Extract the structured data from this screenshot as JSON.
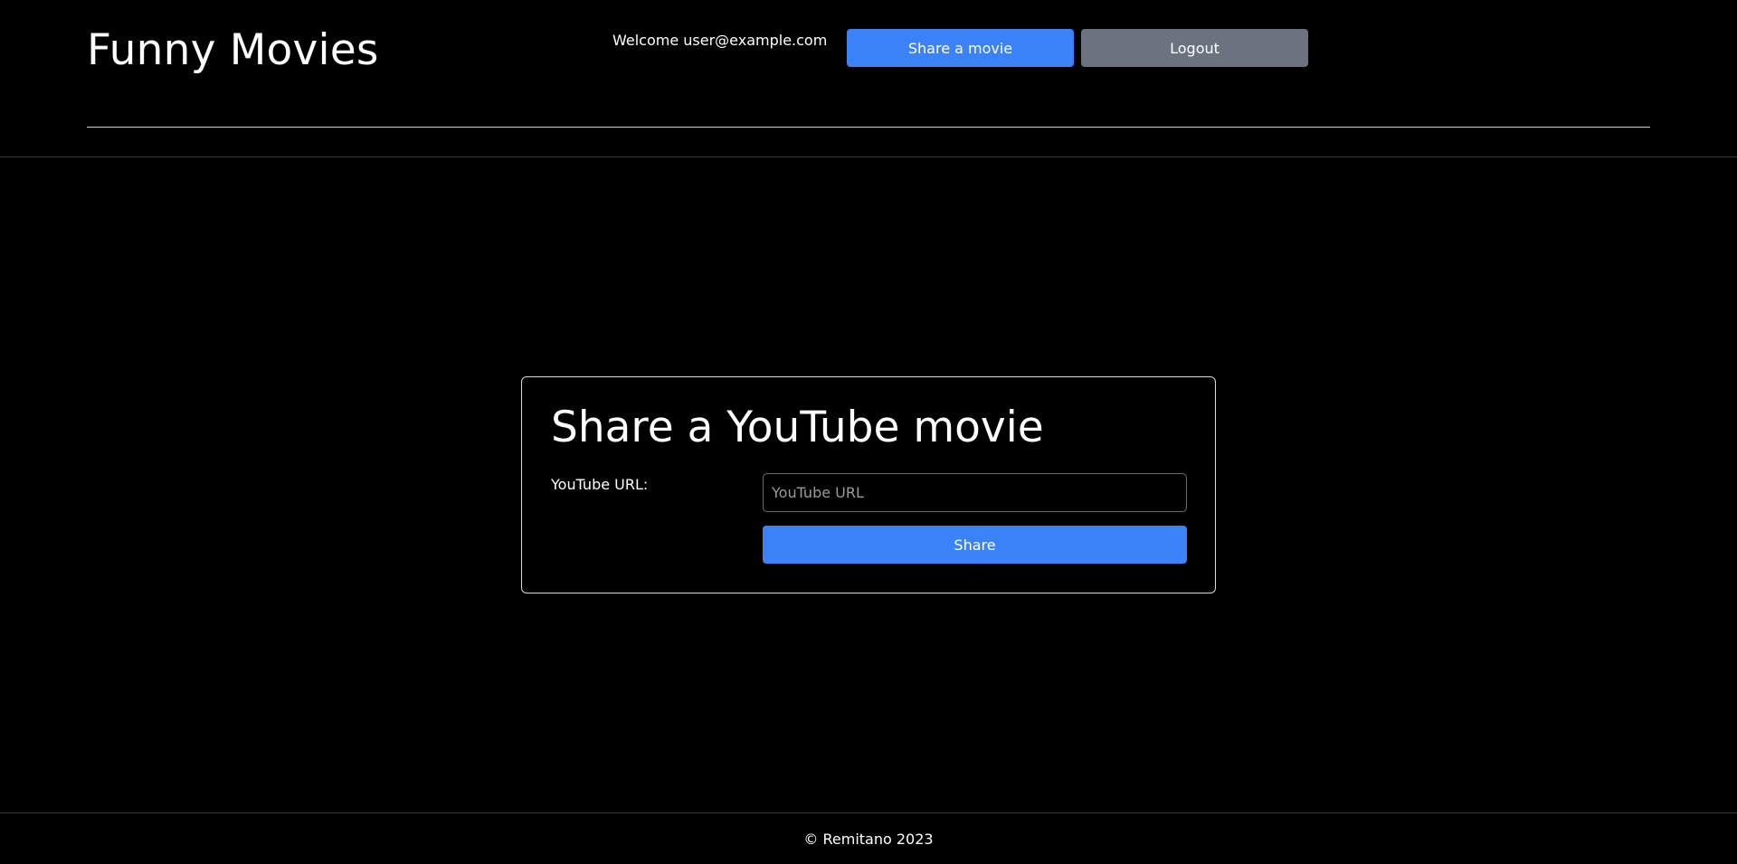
{
  "header": {
    "brand": "Funny Movies",
    "welcome": "Welcome user@example.com",
    "share_button": "Share a movie",
    "logout_button": "Logout"
  },
  "share_form": {
    "title": "Share a YouTube movie",
    "url_label": "YouTube URL:",
    "url_value": "",
    "url_placeholder": "YouTube URL",
    "submit_label": "Share"
  },
  "footer": {
    "text": "© Remitano 2023"
  },
  "colors": {
    "background": "#000000",
    "primary": "#3b82f6",
    "secondary": "#6b7280",
    "text": "#ffffff"
  }
}
